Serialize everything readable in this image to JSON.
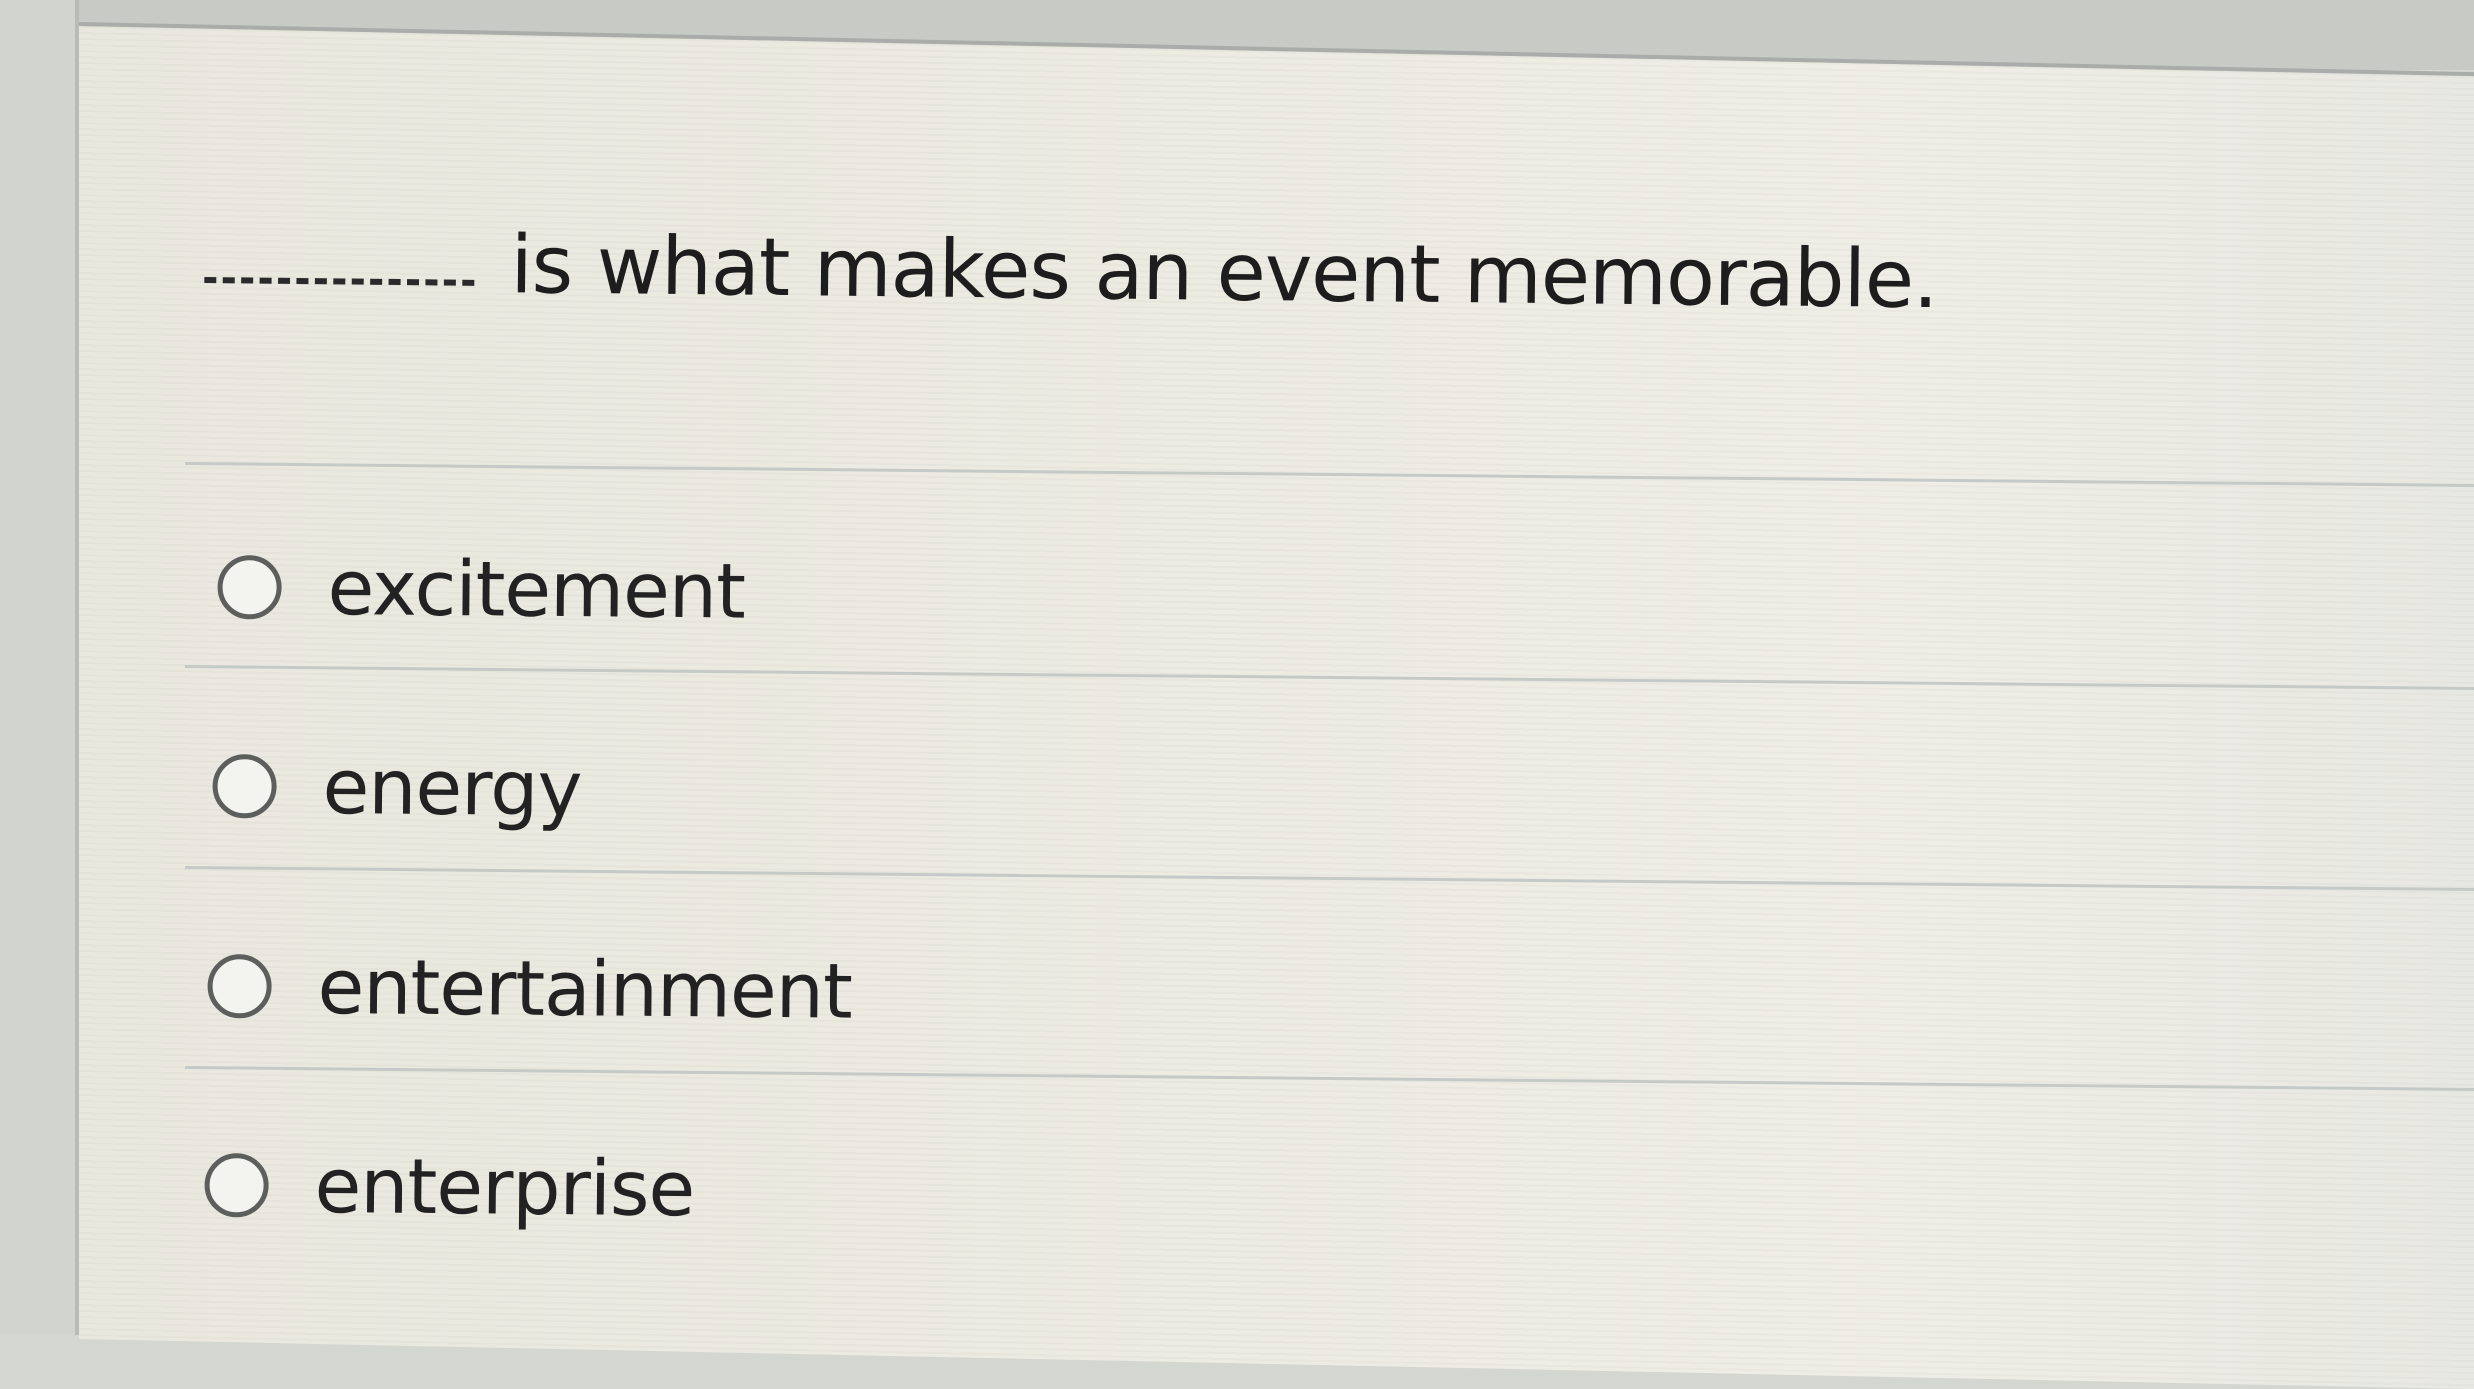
{
  "question": {
    "blank": "",
    "text": "is what makes an event memorable."
  },
  "options": [
    {
      "label": "excitement"
    },
    {
      "label": "energy"
    },
    {
      "label": "entertainment"
    },
    {
      "label": "enterprise"
    }
  ]
}
